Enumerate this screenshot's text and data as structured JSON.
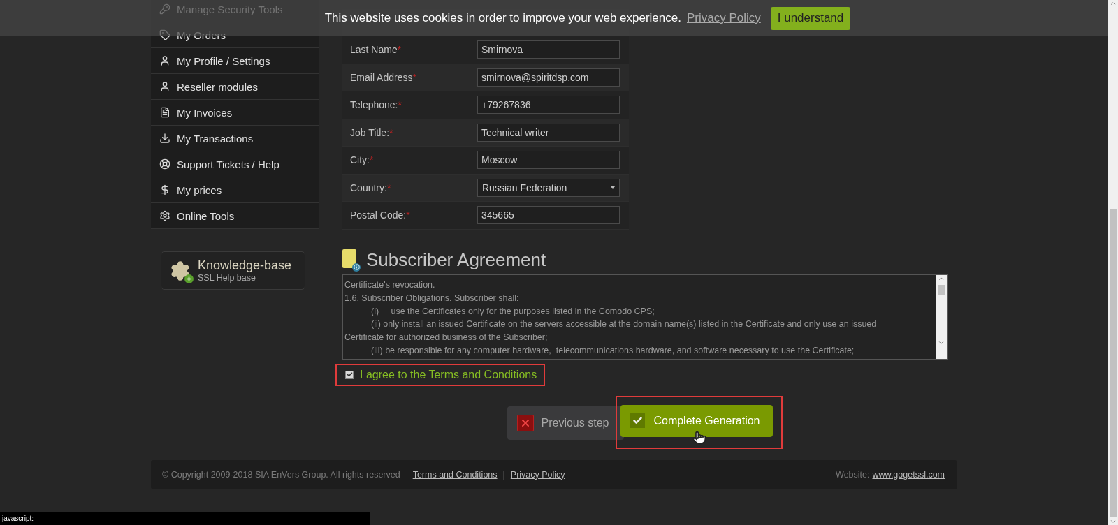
{
  "cookie_bar": {
    "message": "This website uses cookies in order to improve your web experience.",
    "link": "Privacy Policy",
    "button": "I understand"
  },
  "sidebar": {
    "items": [
      {
        "label": "Manage Security Tools"
      },
      {
        "label": "My Orders"
      },
      {
        "label": "My Profile / Settings"
      },
      {
        "label": "Reseller modules"
      },
      {
        "label": "My Invoices"
      },
      {
        "label": "My Transactions"
      },
      {
        "label": "Support Tickets / Help"
      },
      {
        "label": "My prices"
      },
      {
        "label": "Online Tools"
      }
    ],
    "knowledge_base": {
      "title": "Knowledge-base",
      "subtitle": "SSL Help base"
    }
  },
  "form": {
    "rows": [
      {
        "label": "Last Name",
        "required": "*",
        "kind": "input",
        "value": "Smirnova"
      },
      {
        "label": "Email Address",
        "required": "*",
        "kind": "input",
        "value": "smirnova@spiritdsp.com"
      },
      {
        "label": "Telephone:",
        "required": "*",
        "kind": "input",
        "value": "+79267836"
      },
      {
        "label": "Job Title:",
        "required": "*",
        "kind": "input",
        "value": "Technical writer"
      },
      {
        "label": "City:",
        "required": "*",
        "kind": "input",
        "value": "Moscow"
      },
      {
        "label": "Country:",
        "required": "*",
        "kind": "select",
        "value": "Russian Federation"
      },
      {
        "label": "Postal Code:",
        "required": "*",
        "kind": "input",
        "value": "345665"
      }
    ]
  },
  "agreement": {
    "title": "Subscriber Agreement",
    "lines": [
      {
        "text": "Certificate's revocation.",
        "indented": false
      },
      {
        "text": "1.6. Subscriber Obligations. Subscriber shall:",
        "indented": false
      },
      {
        "text": "(i)     use the Certificates only for the purposes listed in the Comodo CPS;",
        "indented": true
      },
      {
        "text": "(ii) only install an issued Certificate on the servers accessible at the domain name(s) listed in the Certificate and only use an issued",
        "indented": true
      },
      {
        "text": "Certificate for authorized business of the Subscriber;",
        "indented": false
      },
      {
        "text": "(iii) be responsible for any computer hardware,  telecommunications hardware, and software necessary to use the Certificate;",
        "indented": true
      }
    ],
    "agree": {
      "label": "I agree to the Terms and Conditions",
      "checked": true
    }
  },
  "buttons": {
    "previous": "Previous step",
    "complete": "Complete Generation"
  },
  "footer": {
    "copyright": "© Copyright 2009-2018 SIA EnVers Group. All rights reserved",
    "links": [
      "Terms and Conditions",
      "Privacy Policy"
    ],
    "separator": "|",
    "website_label": "Website:",
    "website": "www.gogetssl.com"
  },
  "status_bar": {
    "text": "javascript:"
  }
}
